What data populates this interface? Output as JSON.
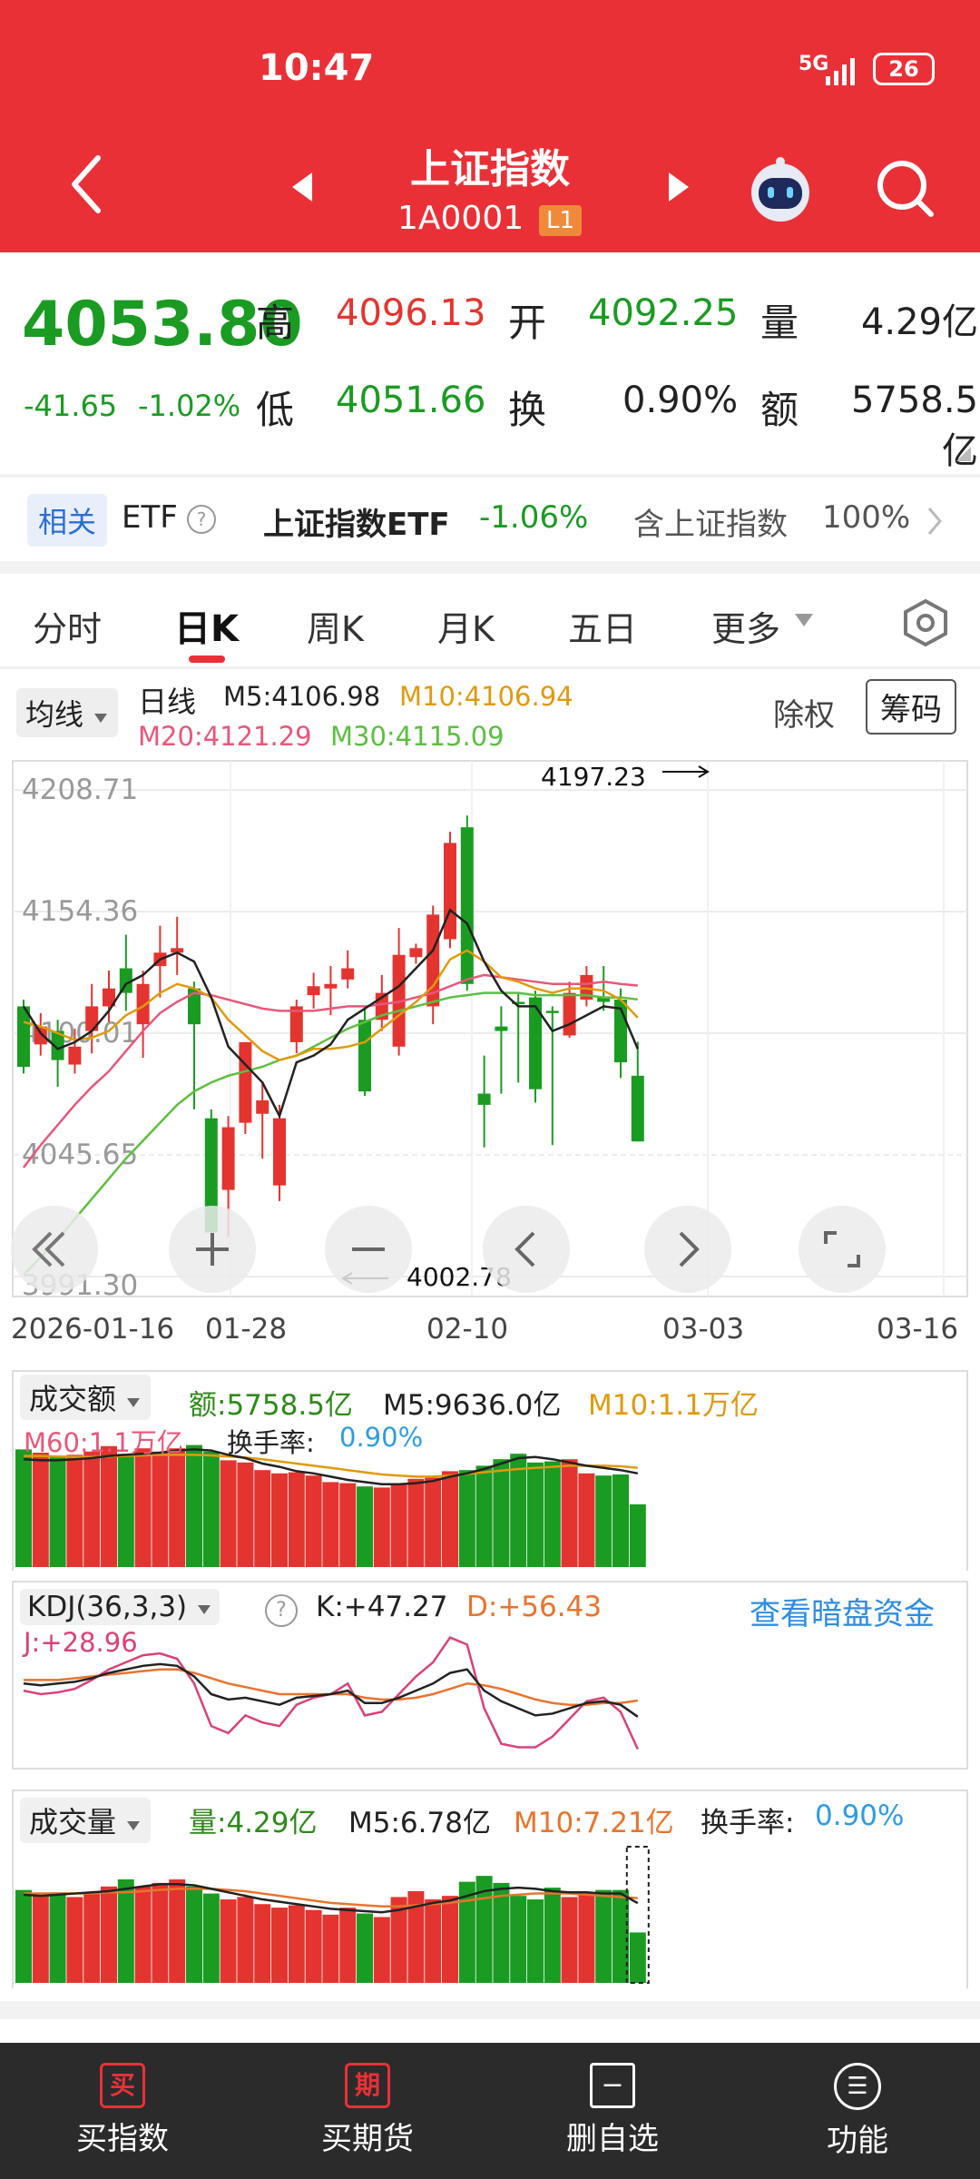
{
  "status_bar": {
    "time": "10:47",
    "network": "5G",
    "battery": "26"
  },
  "header": {
    "title": "上证指数",
    "code": "1A0001",
    "level_badge": "L1"
  },
  "quote": {
    "price": "4053.80",
    "change": "-41.65",
    "change_pct": "-1.02%",
    "high_label": "高",
    "high": "4096.13",
    "open_label": "开",
    "open": "4092.25",
    "volume_label": "量",
    "volume": "4.29亿",
    "low_label": "低",
    "low": "4051.66",
    "turnover_label": "换",
    "turnover": "0.90%",
    "amount_label": "额",
    "amount": "5758.5亿"
  },
  "etf_bar": {
    "tag": "相关",
    "etf_label": "ETF",
    "help": "?",
    "etf_name": "上证指数ETF",
    "etf_change": "-1.06%",
    "holding": "含上证指数",
    "holding_pct": "100%"
  },
  "tabs": [
    "分时",
    "日K",
    "周K",
    "月K",
    "五日",
    "更多"
  ],
  "active_tab": "日K",
  "ma_bar": {
    "selector": "均线",
    "period": "日线",
    "m5": "M5:4106.98",
    "m10": "M10:4106.94",
    "m20": "M20:4121.29",
    "m30": "M30:4115.09",
    "fq_label": "除权",
    "chips_button": "筹码",
    "colors": {
      "m5": "#222222",
      "m10": "#e09a0e",
      "m20": "#e8577a",
      "m30": "#5cbf3f"
    }
  },
  "chart_data": {
    "type": "candlestick",
    "y_ticks": [
      "4208.71",
      "4154.36",
      "4100.01",
      "4045.65",
      "3991.30"
    ],
    "x_labels": [
      "2026-01-16",
      "01-28",
      "02-10",
      "03-03",
      "03-16"
    ],
    "high_annotation": "4197.23",
    "low_annotation": "4002.78",
    "ylim": [
      3991.3,
      4208.71
    ],
    "candles": [
      {
        "o": 4112,
        "c": 4085,
        "h": 4115,
        "l": 4082
      },
      {
        "o": 4095,
        "c": 4103,
        "h": 4109,
        "l": 4090
      },
      {
        "o": 4101,
        "c": 4088,
        "h": 4106,
        "l": 4076
      },
      {
        "o": 4086,
        "c": 4094,
        "h": 4102,
        "l": 4082
      },
      {
        "o": 4101,
        "c": 4112,
        "h": 4122,
        "l": 4091
      },
      {
        "o": 4112,
        "c": 4120,
        "h": 4128,
        "l": 4105
      },
      {
        "o": 4129,
        "c": 4118,
        "h": 4144,
        "l": 4110
      },
      {
        "o": 4104,
        "c": 4122,
        "h": 4128,
        "l": 4089
      },
      {
        "o": 4130,
        "c": 4136,
        "h": 4148,
        "l": 4116
      },
      {
        "o": 4136,
        "c": 4138,
        "h": 4152,
        "l": 4126
      },
      {
        "o": 4120,
        "c": 4104,
        "h": 4123,
        "l": 4066
      },
      {
        "o": 4062,
        "c": 4011,
        "h": 4066,
        "l": 4002.78
      },
      {
        "o": 4030,
        "c": 4058,
        "h": 4063,
        "l": 4009
      },
      {
        "o": 4060,
        "c": 4096,
        "h": 4096,
        "l": 4055
      },
      {
        "o": 4064,
        "c": 4070,
        "h": 4078,
        "l": 4044
      },
      {
        "o": 4032,
        "c": 4062,
        "h": 4068,
        "l": 4025
      },
      {
        "o": 4096,
        "c": 4112,
        "h": 4115,
        "l": 4091
      },
      {
        "o": 4117,
        "c": 4121,
        "h": 4127,
        "l": 4111
      },
      {
        "o": 4120,
        "c": 4122,
        "h": 4130,
        "l": 4108
      },
      {
        "o": 4124,
        "c": 4129,
        "h": 4137,
        "l": 4120
      },
      {
        "o": 4106,
        "c": 4074,
        "h": 4112,
        "l": 4072
      },
      {
        "o": 4106,
        "c": 4118,
        "h": 4126,
        "l": 4101
      },
      {
        "o": 4094,
        "c": 4135,
        "h": 4147,
        "l": 4090
      },
      {
        "o": 4134,
        "c": 4138,
        "h": 4140,
        "l": 4131
      },
      {
        "o": 4112,
        "c": 4153,
        "h": 4157,
        "l": 4104
      },
      {
        "o": 4142,
        "c": 4185,
        "h": 4190,
        "l": 4138
      },
      {
        "o": 4192,
        "c": 4122,
        "h": 4197.23,
        "l": 4119
      },
      {
        "o": 4073,
        "c": 4068,
        "h": 4090,
        "l": 4049
      },
      {
        "o": 4103,
        "c": 4101,
        "h": 4112,
        "l": 4073
      },
      {
        "o": 4114,
        "c": 4113,
        "h": 4118,
        "l": 4078
      },
      {
        "o": 4116,
        "c": 4075,
        "h": 4119,
        "l": 4069
      },
      {
        "o": 4110,
        "c": 4109,
        "h": 4112,
        "l": 4050
      },
      {
        "o": 4099,
        "c": 4118,
        "h": 4123,
        "l": 4098
      },
      {
        "o": 4115,
        "c": 4126,
        "h": 4130,
        "l": 4112
      },
      {
        "o": 4116,
        "c": 4114,
        "h": 4130,
        "l": 4110
      },
      {
        "o": 4115,
        "c": 4087,
        "h": 4120,
        "l": 4080
      },
      {
        "o": 4081,
        "c": 4051.66,
        "h": 4096.13,
        "l": 4051.66
      }
    ],
    "ma5": [
      4112,
      4100,
      4093,
      4096,
      4101,
      4110,
      4122,
      4126,
      4133,
      4136,
      4132,
      4116,
      4094,
      4086,
      4078,
      4063,
      4087,
      4090,
      4095,
      4106,
      4111,
      4116,
      4121,
      4129,
      4137,
      4155,
      4149,
      4132,
      4119,
      4112,
      4112,
      4101,
      4104,
      4108,
      4112,
      4111,
      4093
    ],
    "ma10": [
      4105,
      4103,
      4100,
      4097,
      4098,
      4101,
      4108,
      4112,
      4118,
      4122,
      4120,
      4116,
      4106,
      4099,
      4092,
      4088,
      4090,
      4093,
      4093,
      4094,
      4096,
      4102,
      4108,
      4114,
      4121,
      4133,
      4137,
      4132,
      4125,
      4123,
      4120,
      4118,
      4120,
      4120,
      4119,
      4115,
      4106.94
    ],
    "ma20": [
      4040,
      4050,
      4059,
      4068,
      4076,
      4083,
      4092,
      4101,
      4109,
      4114,
      4118,
      4117,
      4115,
      4113,
      4111,
      4110,
      4110,
      4110,
      4111,
      4112,
      4112,
      4113,
      4114,
      4116,
      4118,
      4121,
      4124,
      4126,
      4125,
      4124,
      4123,
      4122,
      4122,
      4122,
      4123,
      4122,
      4121.29
    ],
    "ma30": [
      3992,
      4000,
      4008,
      4017,
      4026,
      4035,
      4044,
      4052,
      4060,
      4068,
      4074,
      4078,
      4081,
      4083,
      4085,
      4088,
      4090,
      4094,
      4098,
      4102,
      4105,
      4108,
      4110,
      4112,
      4114,
      4116,
      4117,
      4118,
      4118,
      4118,
      4117,
      4117,
      4117,
      4117,
      4116,
      4116,
      4115.09
    ],
    "amount_panel": {
      "selector": "成交额",
      "amount": "额:5758.5亿",
      "m5": "M5:9636.0亿",
      "m10": "M10:1.1万亿",
      "m60": "M60:1.1万亿",
      "turnover_label": "换手率:",
      "turnover": "0.90%",
      "values": [
        10800,
        10500,
        10100,
        10300,
        10600,
        11100,
        10400,
        10900,
        10600,
        10900,
        11200,
        10600,
        9800,
        9600,
        8900,
        8600,
        8700,
        8400,
        7800,
        7700,
        7400,
        7300,
        7600,
        8100,
        8200,
        8800,
        8900,
        9300,
        9900,
        10400,
        9600,
        9700,
        9900,
        8600,
        8400,
        8500,
        5758.5
      ],
      "ma5": [
        9900,
        9800,
        9800,
        9900,
        10000,
        10200,
        10300,
        10400,
        10500,
        10700,
        10800,
        10700,
        10300,
        10000,
        9500,
        9200,
        8800,
        8600,
        8300,
        8000,
        7800,
        7600,
        7600,
        7700,
        7900,
        8300,
        8600,
        9000,
        9500,
        10000,
        10100,
        9900,
        9600,
        9300,
        9100,
        8900,
        8600
      ],
      "ma10": [
        10200,
        10200,
        10150,
        10100,
        10100,
        10150,
        10200,
        10250,
        10300,
        10300,
        10300,
        10250,
        10150,
        10050,
        9900,
        9700,
        9500,
        9300,
        9100,
        8900,
        8700,
        8500,
        8400,
        8300,
        8300,
        8400,
        8550,
        8700,
        8850,
        9000,
        9100,
        9200,
        9300,
        9300,
        9300,
        9250,
        9100
      ]
    },
    "kdj_panel": {
      "selector": "KDJ(36,3,3)",
      "help": "?",
      "k": "K:+47.27",
      "d": "D:+56.43",
      "j": "J:+28.96",
      "link": "查看暗盘资金",
      "kvals": [
        66,
        65,
        66,
        67,
        69,
        72,
        74,
        76,
        77,
        76,
        70,
        60,
        57,
        58,
        56,
        54,
        58,
        59,
        60,
        62,
        55,
        55,
        58,
        62,
        66,
        72,
        74,
        62,
        56,
        52,
        48,
        49,
        52,
        55,
        56,
        54,
        47.27
      ],
      "dvals": [
        68,
        68,
        68,
        69,
        70,
        71,
        72,
        73,
        74,
        74,
        72,
        69,
        66,
        64,
        62,
        60,
        60,
        60,
        60,
        60,
        58,
        57,
        57,
        58,
        60,
        63,
        66,
        65,
        63,
        60,
        57,
        55,
        54,
        54,
        55,
        55,
        56.43
      ],
      "jvals": [
        62,
        60,
        61,
        63,
        68,
        74,
        78,
        82,
        83,
        80,
        66,
        42,
        38,
        48,
        44,
        42,
        54,
        58,
        60,
        66,
        48,
        50,
        60,
        70,
        78,
        92,
        88,
        52,
        32,
        30,
        30,
        36,
        46,
        56,
        58,
        50,
        28.96
      ]
    },
    "volume_panel": {
      "selector": "成交量",
      "volume": "量:4.29亿",
      "m5": "M5:6.78亿",
      "m10": "M10:7.21亿",
      "turnover_label": "换手率:",
      "turnover": "0.90%",
      "values": [
        7.9,
        7.5,
        7.7,
        7.3,
        7.6,
        8.2,
        8.8,
        8.2,
        8.5,
        8.8,
        8.2,
        7.6,
        7.1,
        7.3,
        6.7,
        6.4,
        6.6,
        6.2,
        5.8,
        6.4,
        5.9,
        5.6,
        7.3,
        7.8,
        7.1,
        7.4,
        8.6,
        9.1,
        8.5,
        7.4,
        7.1,
        8.1,
        7.3,
        7.7,
        7.9,
        7.9,
        4.29
      ],
      "ma5": [
        7.5,
        7.4,
        7.5,
        7.6,
        7.7,
        7.8,
        8.0,
        8.2,
        8.4,
        8.4,
        8.3,
        8.0,
        7.7,
        7.4,
        7.1,
        6.9,
        6.7,
        6.5,
        6.3,
        6.2,
        6.1,
        6.0,
        6.2,
        6.5,
        6.8,
        7.0,
        7.4,
        7.8,
        8.0,
        8.1,
        8.0,
        7.8,
        7.7,
        7.7,
        7.6,
        7.6,
        6.78
      ],
      "ma10": [
        7.6,
        7.6,
        7.6,
        7.6,
        7.6,
        7.7,
        7.7,
        7.8,
        7.9,
        8.0,
        8.0,
        8.0,
        7.9,
        7.8,
        7.6,
        7.4,
        7.2,
        7.0,
        6.8,
        6.7,
        6.6,
        6.5,
        6.5,
        6.6,
        6.7,
        6.8,
        7.0,
        7.2,
        7.4,
        7.5,
        7.6,
        7.6,
        7.6,
        7.5,
        7.4,
        7.3,
        7.21
      ]
    }
  },
  "bottom_nav": [
    {
      "icon": "买",
      "label": "买指数"
    },
    {
      "icon": "期",
      "label": "买期货"
    },
    {
      "icon": "−",
      "label": "删自选"
    },
    {
      "icon": "☰",
      "label": "功能"
    }
  ]
}
